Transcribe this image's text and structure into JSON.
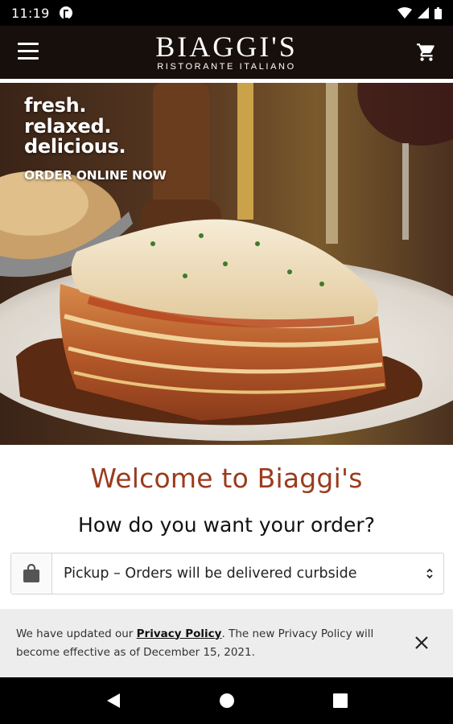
{
  "status_bar": {
    "time": "11:19",
    "icons": [
      "app-notification-icon",
      "wifi-icon",
      "signal-icon",
      "battery-icon"
    ]
  },
  "header": {
    "logo_main": "BIAGGI'S",
    "logo_sub": "RISTORANTE ITALIANO",
    "menu_icon": "hamburger-menu-icon",
    "cart_icon": "shopping-cart-icon"
  },
  "hero": {
    "tagline_line1": "fresh.",
    "tagline_line2": "relaxed.",
    "tagline_line3": "delicious.",
    "cta": "ORDER ONLINE NOW",
    "image_subject": "lasagna"
  },
  "main": {
    "welcome_title": "Welcome to Biaggi's",
    "order_question": "How do you want your order?",
    "order_select": {
      "icon": "shopping-bag-icon",
      "value": "Pickup – Orders will be delivered curbside"
    }
  },
  "privacy_banner": {
    "text_before": "We have updated our ",
    "link_text": "Privacy Policy",
    "text_after": ". The new Privacy Policy will become effective as of December 15, 2021.",
    "close_icon": "close-icon"
  },
  "nav_bar": {
    "icons": [
      "back-icon",
      "home-icon",
      "recents-icon"
    ]
  },
  "colors": {
    "header_bg": "#170f0c",
    "welcome_title": "#9b3b1e",
    "banner_bg": "#ededed"
  }
}
